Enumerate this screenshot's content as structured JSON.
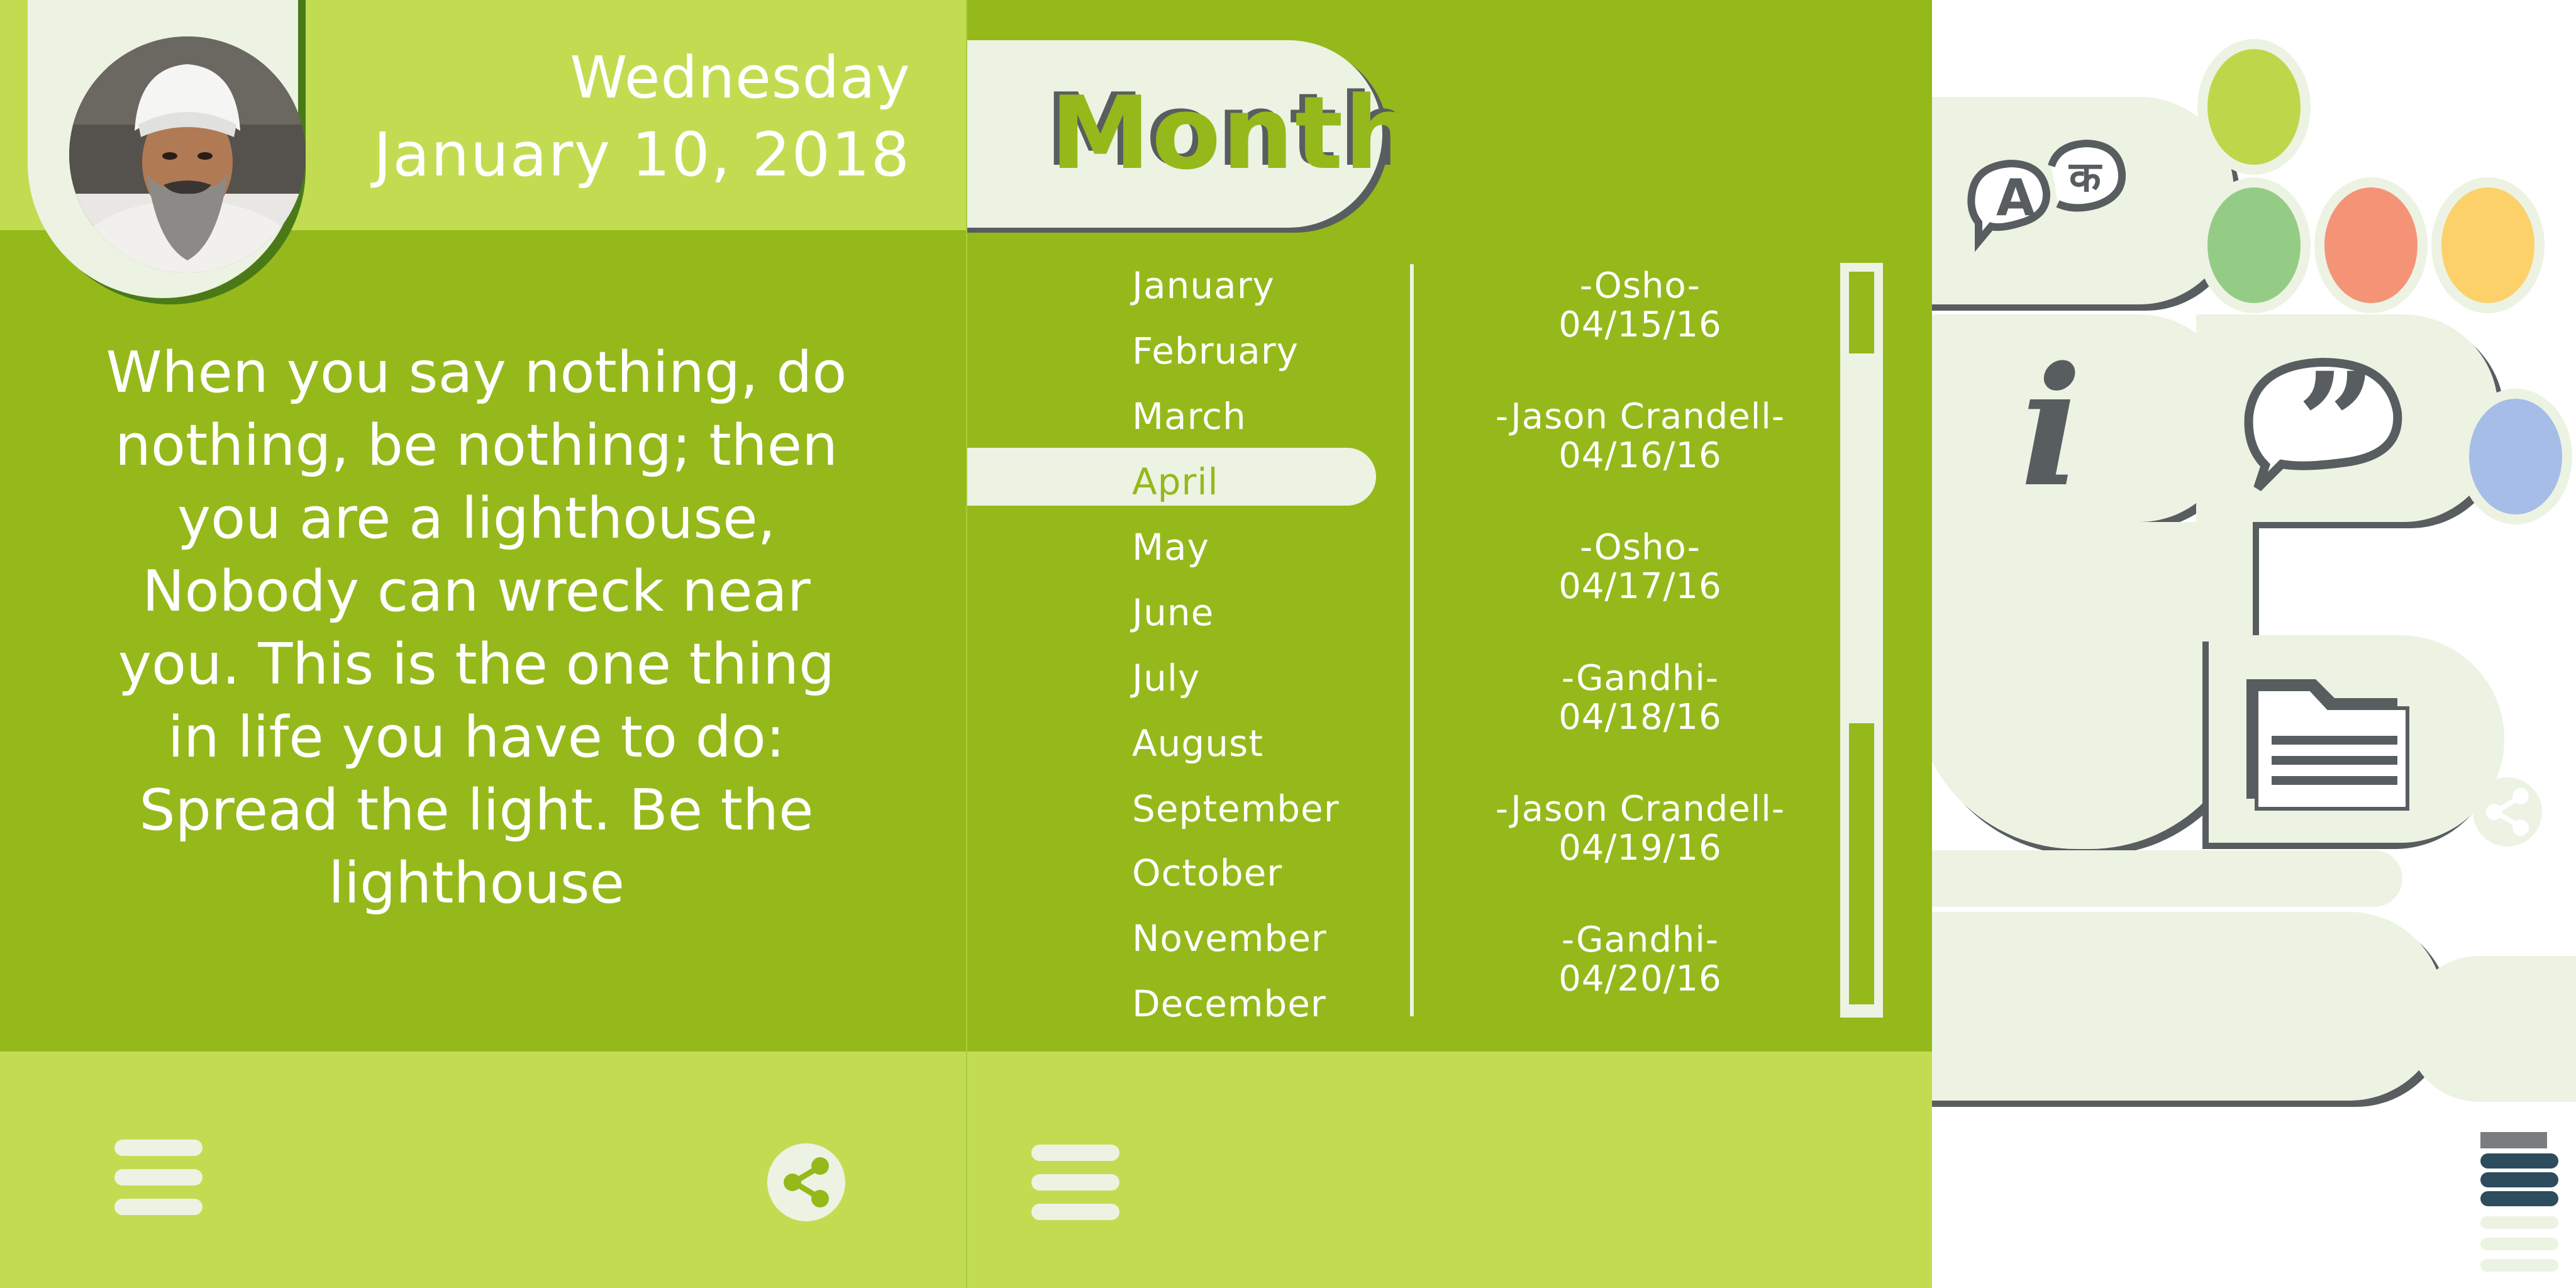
{
  "quote_screen": {
    "date": {
      "weekday": "Wednesday",
      "full_date": "January 10, 2018"
    },
    "quote_text": "When you say nothing, do nothing, be nothing; then you are a lighthouse, Nobody can wreck near you. This is the one thing in life you have to do: Spread the light. Be the lighthouse",
    "colors": {
      "primary": "#95b91b",
      "light": "#c2dc52",
      "surface": "#ecf3e3",
      "shadow": "#4a7a18"
    }
  },
  "month_screen": {
    "title": "Month",
    "months": [
      "January",
      "February",
      "March",
      "April",
      "May",
      "June",
      "July",
      "August",
      "September",
      "October",
      "November",
      "December"
    ],
    "selected_month": "April",
    "entries": [
      {
        "author": "-Osho-",
        "date": "04/15/16"
      },
      {
        "author": "-Jason Crandell-",
        "date": "04/16/16"
      },
      {
        "author": "-Osho-",
        "date": "04/17/16"
      },
      {
        "author": "-Gandhi-",
        "date": "04/18/16"
      },
      {
        "author": "-Jason Crandell-",
        "date": "04/19/16"
      },
      {
        "author": "-Gandhi-",
        "date": "04/20/16"
      }
    ]
  },
  "asset_sheet": {
    "icons": [
      "translate-icon",
      "info-icon",
      "quote-icon",
      "document-icon",
      "share-icon",
      "menu-icon"
    ],
    "translate_glyph_latin": "A",
    "translate_glyph_other": "क",
    "info_glyph": "i",
    "quote_glyph": "”",
    "swatches": [
      {
        "name": "lime",
        "color": "#bcd84a"
      },
      {
        "name": "green",
        "color": "#95cc85"
      },
      {
        "name": "salmon",
        "color": "#f59377"
      },
      {
        "name": "amber",
        "color": "#fcd16a"
      },
      {
        "name": "blue",
        "color": "#a6bde7"
      }
    ]
  }
}
